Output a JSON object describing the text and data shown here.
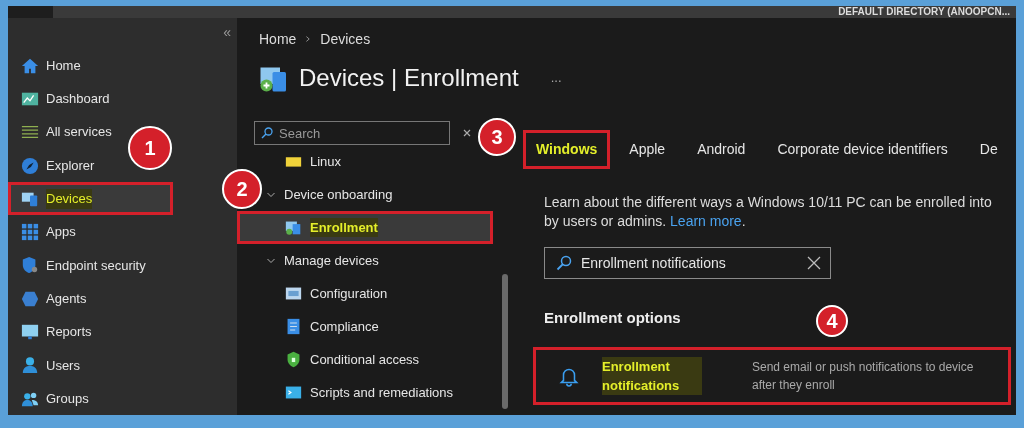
{
  "top_bar": {
    "directory": "DEFAULT DIRECTORY (ANOOPCN..."
  },
  "sidebar": {
    "collapse": "«",
    "items": [
      {
        "label": "Home",
        "selected": false,
        "highlighted": false
      },
      {
        "label": "Dashboard",
        "selected": false,
        "highlighted": false
      },
      {
        "label": "All services",
        "selected": false,
        "highlighted": false
      },
      {
        "label": "Explorer",
        "selected": false,
        "highlighted": false
      },
      {
        "label": "Devices",
        "selected": true,
        "highlighted": true
      },
      {
        "label": "Apps",
        "selected": false,
        "highlighted": false
      },
      {
        "label": "Endpoint security",
        "selected": false,
        "highlighted": false
      },
      {
        "label": "Agents",
        "selected": false,
        "highlighted": false
      },
      {
        "label": "Reports",
        "selected": false,
        "highlighted": false
      },
      {
        "label": "Users",
        "selected": false,
        "highlighted": false
      },
      {
        "label": "Groups",
        "selected": false,
        "highlighted": false
      }
    ]
  },
  "breadcrumb": [
    "Home",
    "Devices"
  ],
  "page_title": "Devices | Enrollment",
  "more": "...",
  "menu": {
    "search": {
      "placeholder": "Search"
    },
    "items": [
      {
        "kind": "item",
        "label": "Linux",
        "selected": false,
        "highlighted": false
      },
      {
        "kind": "group",
        "label": "Device onboarding",
        "expanded": true,
        "children": [
          {
            "kind": "item",
            "label": "Enrollment",
            "selected": true,
            "highlighted": true
          }
        ]
      },
      {
        "kind": "group",
        "label": "Manage devices",
        "expanded": true,
        "children": [
          {
            "kind": "item",
            "label": "Configuration",
            "selected": false,
            "highlighted": false
          },
          {
            "kind": "item",
            "label": "Compliance",
            "selected": false,
            "highlighted": false
          },
          {
            "kind": "item",
            "label": "Conditional access",
            "selected": false,
            "highlighted": false
          },
          {
            "kind": "item",
            "label": "Scripts and remediations",
            "selected": false,
            "highlighted": false
          }
        ]
      }
    ]
  },
  "tabs": [
    {
      "label": "Windows",
      "selected": true,
      "highlighted": true
    },
    {
      "label": "Apple",
      "selected": false,
      "highlighted": false
    },
    {
      "label": "Android",
      "selected": false,
      "highlighted": false
    },
    {
      "label": "Corporate device identifiers",
      "selected": false,
      "highlighted": false
    },
    {
      "label": "De",
      "selected": false,
      "highlighted": false
    }
  ],
  "description": {
    "line_1": "Learn about the different ways a Windows 10/11 PC can be enrolled into",
    "line_2": "by users or admins.",
    "link": "Learn more",
    "after_link": "."
  },
  "filter": {
    "value": "Enrollment notifications"
  },
  "options": {
    "heading": "Enrollment options",
    "rows": [
      {
        "title": "Enrollment notifications",
        "description_1": "Send email or push notifications to device",
        "description_2": "after they enroll",
        "highlighted": true
      }
    ]
  },
  "callouts": [
    {
      "number": "1"
    },
    {
      "number": "2"
    },
    {
      "number": "3"
    },
    {
      "number": "4"
    }
  ]
}
